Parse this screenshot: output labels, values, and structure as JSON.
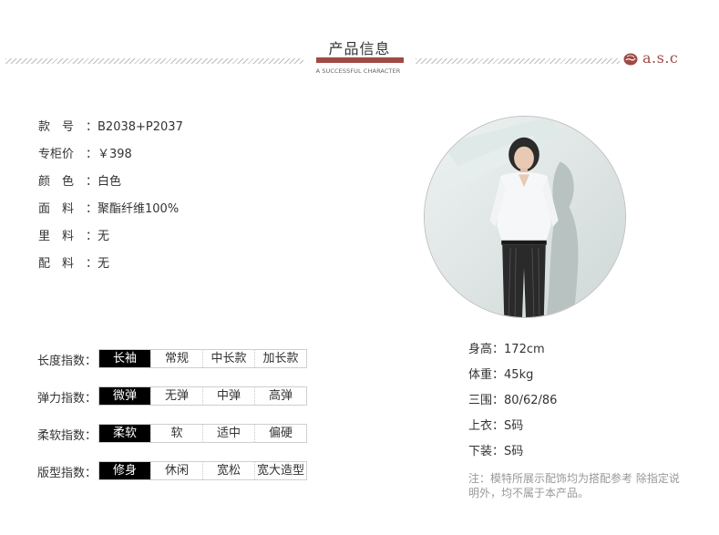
{
  "header": {
    "title": "产品信息",
    "subtitle": "A SUCCESSFUL CHARACTER",
    "logo_text": "a.s.c"
  },
  "product_info": [
    {
      "key": "款　号",
      "value": "B2038+P2037"
    },
    {
      "key": "专柜价",
      "value": "￥398"
    },
    {
      "key": "颜　色",
      "value": "白色"
    },
    {
      "key": "面　料",
      "value": "聚酯纤维100%"
    },
    {
      "key": "里　料",
      "value": "无"
    },
    {
      "key": "配　料",
      "value": "无"
    }
  ],
  "indices": [
    {
      "label": "长度指数：",
      "options": [
        "长袖",
        "常规",
        "中长款",
        "加长款"
      ],
      "selected": 0
    },
    {
      "label": "弹力指数：",
      "options": [
        "微弹",
        "无弹",
        "中弹",
        "高弹"
      ],
      "selected": 0
    },
    {
      "label": "柔软指数：",
      "options": [
        "柔软",
        "软",
        "适中",
        "偏硬"
      ],
      "selected": 0
    },
    {
      "label": "版型指数：",
      "options": [
        "修身",
        "休闲",
        "宽松",
        "宽大造型"
      ],
      "selected": 0
    }
  ],
  "model": [
    {
      "key": "身高",
      "value": "172cm"
    },
    {
      "key": "体重",
      "value": "45kg"
    },
    {
      "key": "三围",
      "value": "80/62/86"
    },
    {
      "key": "上衣",
      "value": "S码"
    },
    {
      "key": "下装",
      "value": "S码"
    }
  ],
  "note": "注：模特所展示配饰均为搭配参考 除指定说明外，均不属于本产品。",
  "colors": {
    "accent": "#a04a45",
    "active_bg": "#000000",
    "note": "#999999"
  }
}
